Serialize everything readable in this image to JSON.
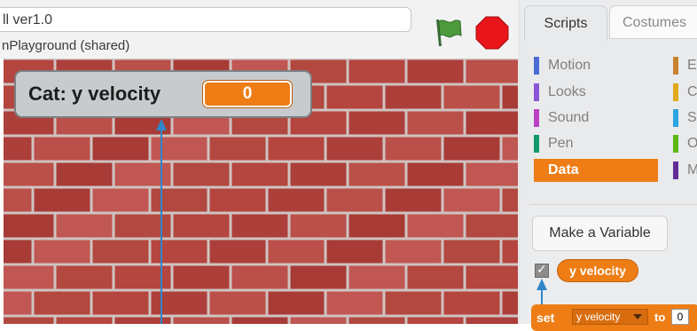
{
  "project": {
    "title_value": "ll ver1.0",
    "author_line": "nPlayground (shared)"
  },
  "controls": {
    "green_flag_icon": "green-flag-icon",
    "stop_icon": "stop-sign-icon"
  },
  "stage": {
    "monitor": {
      "label": "Cat: y velocity",
      "value": "0"
    }
  },
  "tabs": [
    {
      "label": "Scripts",
      "active": true
    },
    {
      "label": "Costumes",
      "active": false
    }
  ],
  "categories": [
    {
      "label": "Motion",
      "color": "#4a6cd4"
    },
    {
      "label": "Looks",
      "color": "#8a55d7"
    },
    {
      "label": "Sound",
      "color": "#bb42c3"
    },
    {
      "label": "Pen",
      "color": "#0e9a6c"
    },
    {
      "label": "Data",
      "color": "#ee7d16",
      "selected": true
    },
    {
      "label": "E",
      "color": "#c88330"
    },
    {
      "label": "C",
      "color": "#e1a91a"
    },
    {
      "label": "S",
      "color": "#2ca5e2"
    },
    {
      "label": "O",
      "color": "#5cb712"
    },
    {
      "label": "M",
      "color": "#632d99"
    }
  ],
  "palette": {
    "make_variable_label": "Make a Variable",
    "variable_checkbox_checked": true,
    "variable_reporter": "y velocity",
    "set_block": {
      "verb": "set",
      "variable": "y velocity",
      "to_word": "to",
      "value": "0"
    }
  },
  "colors": {
    "data_orange": "#ee7d16",
    "annotation_arrow": "#2f86c8"
  }
}
